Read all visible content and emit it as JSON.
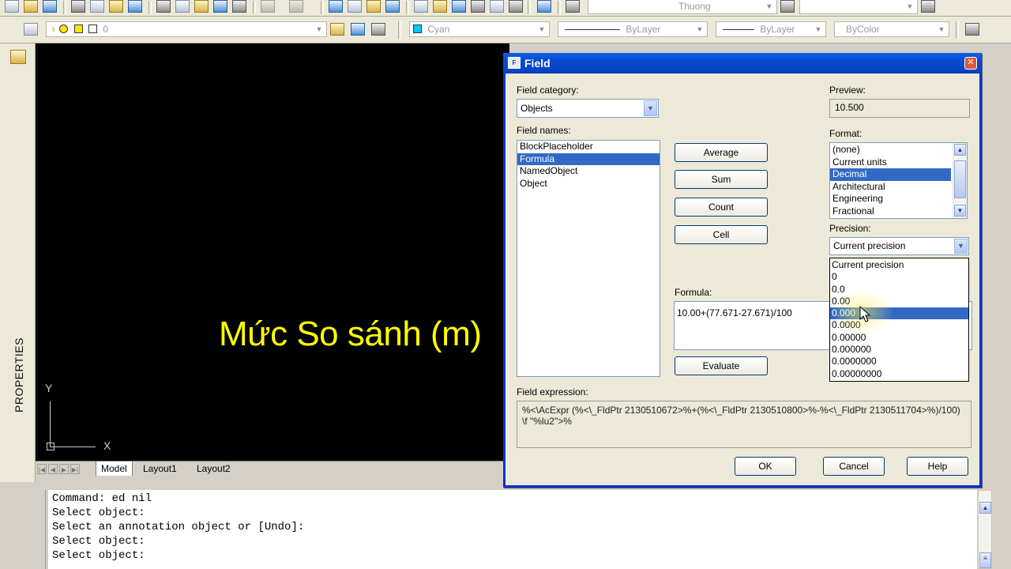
{
  "toolbar": {
    "textstyle_value": "Thuong",
    "layer_value": "0",
    "color_value": "Cyan",
    "linetype_value": "ByLayer",
    "lineweight_value": "ByLayer",
    "plotstyle_value": "ByColor",
    "colors": {
      "cyan": "#00c8ff"
    }
  },
  "palette": {
    "properties_label": "PROPERTIES"
  },
  "drawing": {
    "text": "Mức So sánh (m)",
    "ucs_x": "X",
    "ucs_y": "Y",
    "text_color": "#ffff00"
  },
  "layout_tabs": [
    {
      "label": "Model"
    },
    {
      "label": "Layout1"
    },
    {
      "label": "Layout2"
    }
  ],
  "command": {
    "lines": "Command: ed nil\nSelect object:\nSelect an annotation object or [Undo]:\nSelect object:\nSelect object:"
  },
  "dialog": {
    "title": "Field",
    "field_category_label": "Field category:",
    "field_category_value": "Objects",
    "field_names_label": "Field names:",
    "field_names": [
      "BlockPlaceholder",
      "Formula",
      "NamedObject",
      "Object"
    ],
    "field_names_selected": 1,
    "buttons": {
      "average": "Average",
      "sum": "Sum",
      "count": "Count",
      "cell": "Cell",
      "evaluate": "Evaluate",
      "ok": "OK",
      "cancel": "Cancel",
      "help": "Help"
    },
    "formula_label": "Formula:",
    "formula_value": "10.00+(77.671-27.671)/100",
    "preview_label": "Preview:",
    "preview_value": "10.500",
    "format_label": "Format:",
    "formats": [
      "(none)",
      "Current units",
      "Decimal",
      "Architectural",
      "Engineering",
      "Fractional"
    ],
    "format_selected": 2,
    "precision_label": "Precision:",
    "precision_value": "Current precision",
    "precision_options": [
      "Current precision",
      "0",
      "0.0",
      "0.00",
      "0.000",
      "0.0000",
      "0.00000",
      "0.000000",
      "0.0000000",
      "0.00000000"
    ],
    "precision_highlighted": 4,
    "field_expression_label": "Field expression:",
    "field_expression": "%<\\AcExpr (%<\\_FldPtr 2130510672>%+(%<\\_FldPtr 2130510800>%-%<\\_FldPtr 2130511704>%)/100) \\f \"%lu2\">%"
  }
}
